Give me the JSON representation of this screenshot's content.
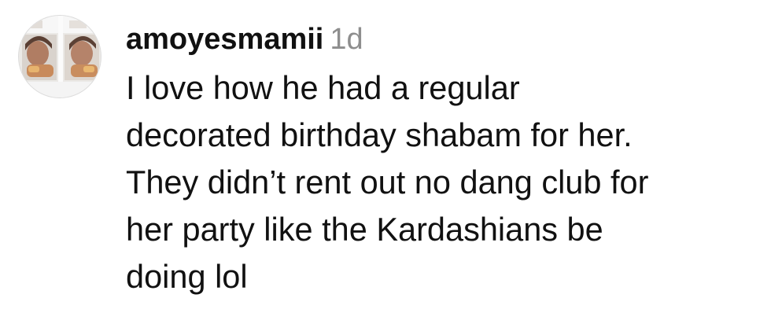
{
  "comment": {
    "username": "amoyesmamii",
    "timestamp": "1d",
    "text_lines": [
      "I love how he had a regular",
      "decorated birthday shabam for her.",
      "They didn’t rent out no dang club for",
      "her party like the Kardashians be",
      "doing lol"
    ]
  },
  "colors": {
    "text": "#111111",
    "timestamp": "#8e8e8e",
    "background": "#ffffff"
  },
  "icons": {
    "avatar": "profile-photo"
  }
}
